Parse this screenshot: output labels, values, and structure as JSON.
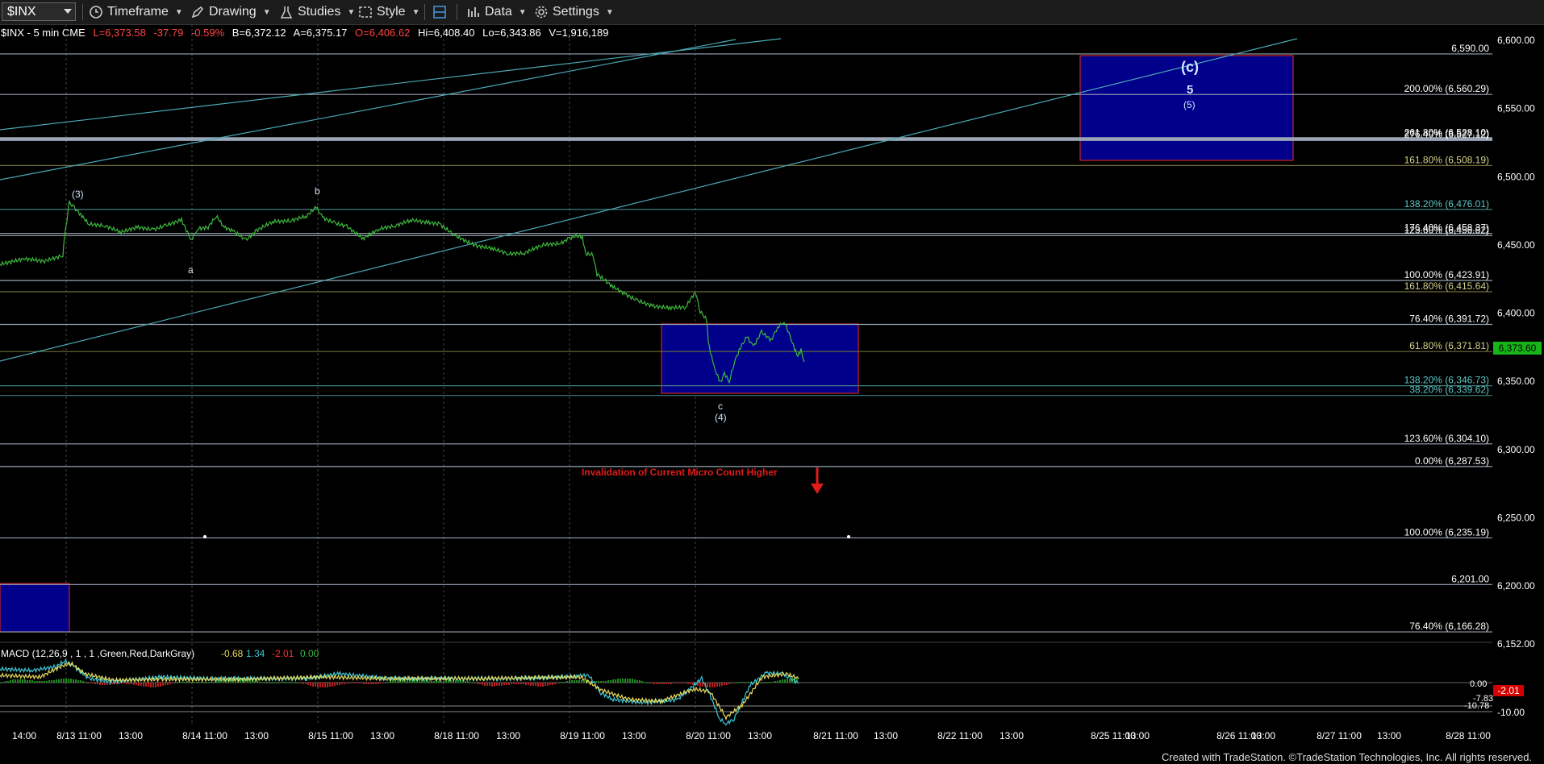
{
  "toolbar": {
    "symbol": "$INX",
    "timeframe": "Timeframe",
    "drawing": "Drawing",
    "studies": "Studies",
    "style": "Style",
    "data": "Data",
    "settings": "Settings"
  },
  "quote": {
    "title": "$INX - 5 min  CME",
    "last": "L=6,373.58",
    "change": "-37.79",
    "pct": "-0.59%",
    "bid": "B=6,372.12",
    "ask": "A=6,375.17",
    "open": "O=6,406.62",
    "high": "Hi=6,408.40",
    "low": "Lo=6,343.86",
    "volume": "V=1,916,189"
  },
  "price_axis": [
    "6,600.00",
    "6,550.00",
    "6,500.00",
    "6,450.00",
    "6,400.00",
    "6,350.00",
    "6,300.00",
    "6,250.00",
    "6,200.00"
  ],
  "price_axis_partial": "6,152.00",
  "time_axis": [
    "14:00",
    "8/13 11:00",
    "13:00",
    "8/14 11:00",
    "13:00",
    "8/15 11:00",
    "13:00",
    "8/18 11:00",
    "13:00",
    "8/19 11:00",
    "13:00",
    "8/20 11:00",
    "13:00",
    "8/21 11:00",
    "13:00",
    "8/22 11:00",
    "13:00",
    "8/25 11:00",
    "13:00",
    "8/26 11:00",
    "13:00",
    "8/27 11:00",
    "13:00",
    "8/28 11:00"
  ],
  "fib_labels": [
    {
      "text": "6,590.00",
      "price": 6590,
      "color": "#ffffff"
    },
    {
      "text": "200.00% (6,560.29)",
      "price": 6560.29,
      "color": "#ffffff"
    },
    {
      "text": "261.80% (6,528.10)",
      "price": 6528.1,
      "color": "#ffffff"
    },
    {
      "text": "276.40% (6,527.12)",
      "price": 6527.12,
      "color": "#ffffff"
    },
    {
      "text": "161.80% (6,508.19)",
      "price": 6508.19,
      "color": "#d4d48a"
    },
    {
      "text": "138.20% (6,476.01)",
      "price": 6476.01,
      "color": "#5fc7c7"
    },
    {
      "text": "176.40% (6,458.37)",
      "price": 6458.37,
      "color": "#ffffff"
    },
    {
      "text": "123.60% (6,456.82)",
      "price": 6456.82,
      "color": "#ffffff"
    },
    {
      "text": "100.00% (6,423.91)",
      "price": 6423.91,
      "color": "#ffffff"
    },
    {
      "text": "161.80% (6,415.64)",
      "price": 6415.64,
      "color": "#d4d48a"
    },
    {
      "text": "76.40% (6,391.72)",
      "price": 6391.72,
      "color": "#ffffff"
    },
    {
      "text": "61.80% (6,371.81)",
      "price": 6371.81,
      "color": "#d4d48a"
    },
    {
      "text": "138.20% (6,346.73)",
      "price": 6346.73,
      "color": "#5fc7c7"
    },
    {
      "text": "38.20% (6,339.62)",
      "price": 6339.62,
      "color": "#5fc7c7"
    },
    {
      "text": "123.60% (6,304.10)",
      "price": 6304.1,
      "color": "#ffffff"
    },
    {
      "text": "0.00% (6,287.53)",
      "price": 6287.53,
      "color": "#ffffff"
    },
    {
      "text": "100.00% (6,235.19)",
      "price": 6235.19,
      "color": "#ffffff"
    },
    {
      "text": "6,201.00",
      "price": 6201,
      "color": "#ffffff"
    },
    {
      "text": "76.40% (6,166.28)",
      "price": 6166.28,
      "color": "#ffffff"
    }
  ],
  "wave_labels": {
    "w3": "(3)",
    "a": "a",
    "b": "b",
    "c": "c",
    "w4": "(4)",
    "wc": "(c)",
    "w5": "5",
    "w5p": "(5)"
  },
  "annotation": "Invalidation of Current Micro Count Higher",
  "price_badge": "6,373.60",
  "macd": {
    "title": "MACD (12,26,9 , 1 , 1 ,Green,Red,DarkGray)",
    "v1": "-0.68",
    "v2": "1.34",
    "v3": "-2.01",
    "v4": "0.00",
    "axis": [
      "0.00",
      "-7.83",
      "-10.78",
      "-10.00"
    ],
    "badge": "-2.01"
  },
  "footer": "Created with TradeStation. ©TradeStation Technologies, Inc. All rights reserved.",
  "colors": {
    "price": "#3cb83c",
    "trend": "#4aa8b4",
    "box": "#00008b",
    "box_border": "#cc2222",
    "invalid": "#e01b1b"
  }
}
